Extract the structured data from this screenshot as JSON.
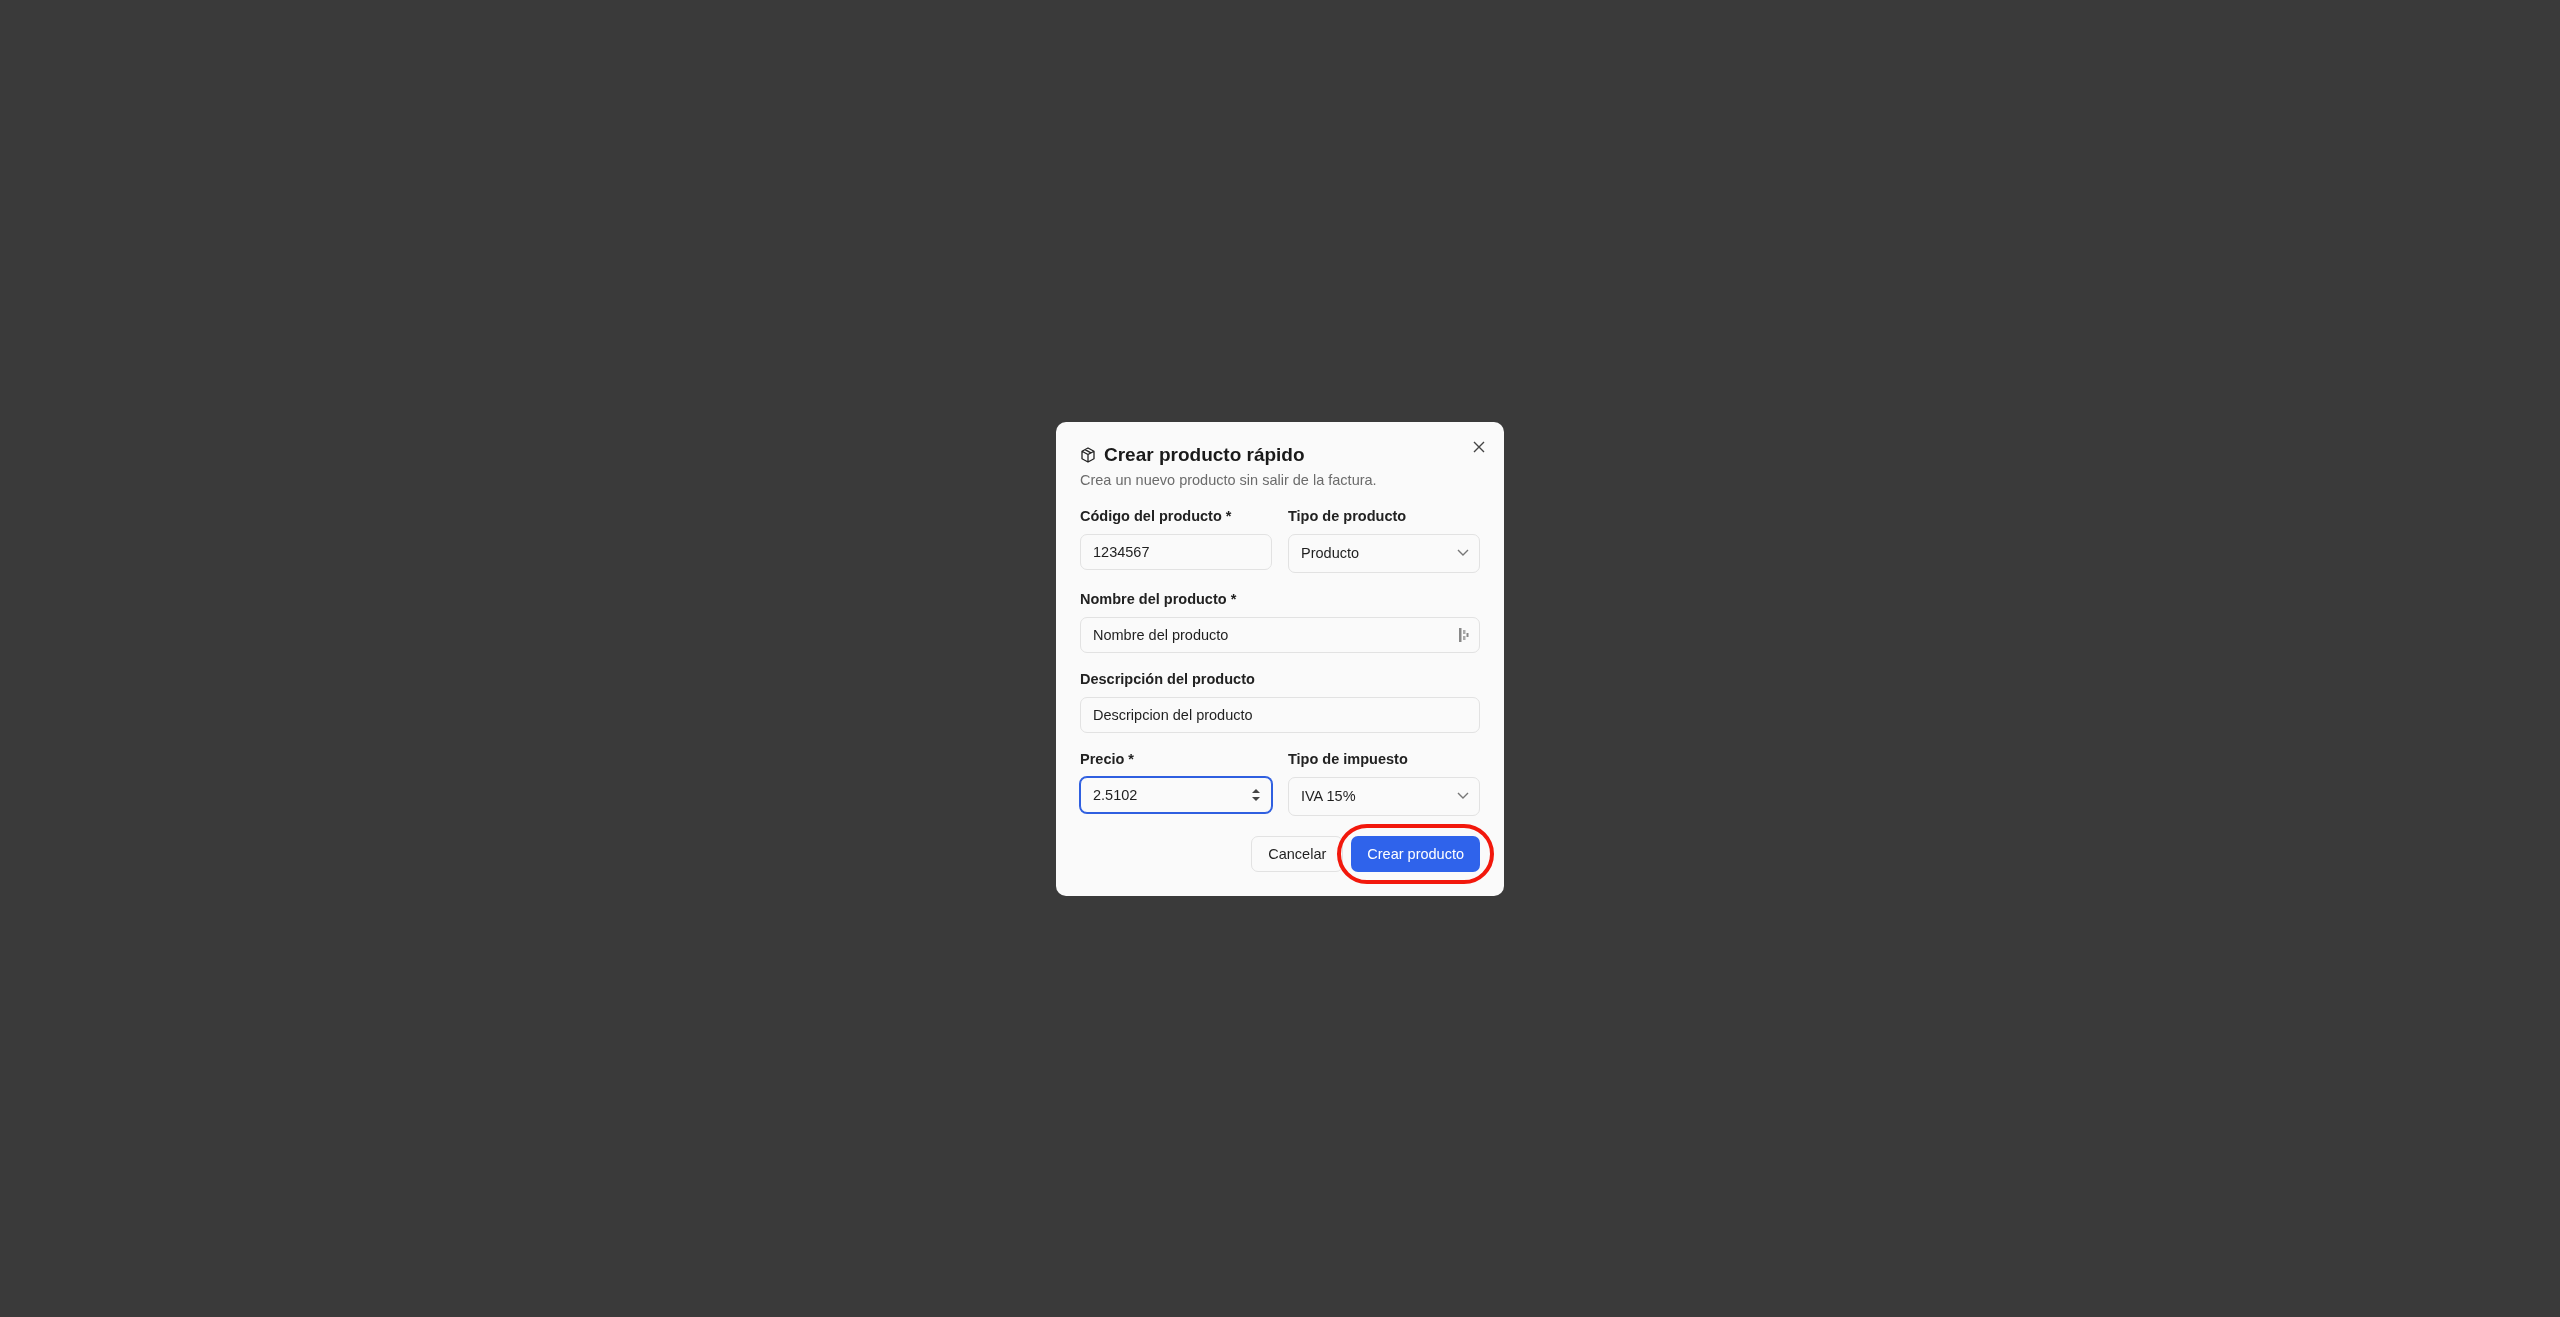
{
  "dialog": {
    "title": "Crear producto rápido",
    "description": "Crea un nuevo producto sin salir de la factura.",
    "rows": [
      [
        {
          "kind": "text",
          "label": "Código del producto *",
          "value": "1234567",
          "focused": false
        },
        {
          "kind": "select",
          "label": "Tipo de producto",
          "value": "Producto",
          "focused": false
        }
      ],
      [
        {
          "kind": "text",
          "label": "Nombre del producto *",
          "value": "Nombre del producto",
          "focused": false,
          "autofill": true
        }
      ],
      [
        {
          "kind": "text",
          "label": "Descripción del producto",
          "value": "Descripcion del producto",
          "focused": false
        }
      ],
      [
        {
          "kind": "number",
          "label": "Precio *",
          "value": "2.5102",
          "focused": true
        },
        {
          "kind": "select",
          "label": "Tipo de impuesto",
          "value": "IVA 15%",
          "focused": false
        }
      ]
    ],
    "buttons": [
      {
        "kind": "secondary",
        "label": "Cancelar",
        "highlighted": false
      },
      {
        "kind": "primary",
        "label": "Crear producto",
        "highlighted": true
      }
    ]
  }
}
